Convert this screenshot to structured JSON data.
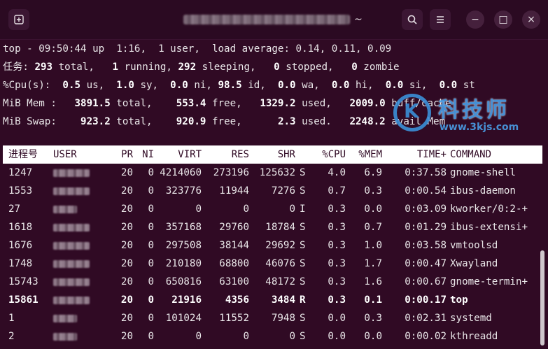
{
  "window": {
    "title_suffix": "~",
    "buttons": {
      "new_tab_icon": "new-tab-icon",
      "search_icon": "search-icon",
      "menu_icon": "hamburger-menu-icon",
      "minimize_label": "−",
      "maximize_label": "□",
      "close_label": "×"
    }
  },
  "summary": [
    [
      {
        "t": "top - 09:50:44 up  1:16,  1 user,  load average: 0.14, 0.11, 0.09"
      }
    ],
    [
      {
        "t": "任务: "
      },
      {
        "t": "293",
        "b": true
      },
      {
        "t": " total,   "
      },
      {
        "t": "1",
        "b": true
      },
      {
        "t": " running, "
      },
      {
        "t": "292",
        "b": true
      },
      {
        "t": " sleeping,   "
      },
      {
        "t": "0",
        "b": true
      },
      {
        "t": " stopped,   "
      },
      {
        "t": "0",
        "b": true
      },
      {
        "t": " zombie"
      }
    ],
    [
      {
        "t": "%Cpu(s):  "
      },
      {
        "t": "0.5",
        "b": true
      },
      {
        "t": " us,  "
      },
      {
        "t": "1.0",
        "b": true
      },
      {
        "t": " sy,  "
      },
      {
        "t": "0.0",
        "b": true
      },
      {
        "t": " ni, "
      },
      {
        "t": "98.5",
        "b": true
      },
      {
        "t": " id,  "
      },
      {
        "t": "0.0",
        "b": true
      },
      {
        "t": " wa,  "
      },
      {
        "t": "0.0",
        "b": true
      },
      {
        "t": " hi,  "
      },
      {
        "t": "0.0",
        "b": true
      },
      {
        "t": " si,  "
      },
      {
        "t": "0.0",
        "b": true
      },
      {
        "t": " st"
      }
    ],
    [
      {
        "t": "MiB Mem :   "
      },
      {
        "t": "3891.5",
        "b": true
      },
      {
        "t": " total,    "
      },
      {
        "t": "553.4",
        "b": true
      },
      {
        "t": " free,   "
      },
      {
        "t": "1329.2",
        "b": true
      },
      {
        "t": " used,   "
      },
      {
        "t": "2009.0",
        "b": true
      },
      {
        "t": " buff/cache"
      }
    ],
    [
      {
        "t": "MiB Swap:    "
      },
      {
        "t": "923.2",
        "b": true
      },
      {
        "t": " total,    "
      },
      {
        "t": "920.9",
        "b": true
      },
      {
        "t": " free,      "
      },
      {
        "t": "2.3",
        "b": true
      },
      {
        "t": " used.   "
      },
      {
        "t": "2248.2",
        "b": true
      },
      {
        "t": " avail Mem"
      }
    ]
  ],
  "table": {
    "columns": [
      "进程号",
      "USER",
      "PR",
      "NI",
      "VIRT",
      "RES",
      "SHR",
      "",
      "%CPU",
      "%MEM",
      "TIME+",
      "COMMAND"
    ],
    "rows": [
      {
        "pid": "1247",
        "user_w": 52,
        "pr": "20",
        "ni": "0",
        "virt": "4214060",
        "res": "273196",
        "shr": "125632",
        "s": "S",
        "cpu": "4.0",
        "mem": "6.9",
        "time": "0:37.58",
        "cmd": "gnome-shell"
      },
      {
        "pid": "1553",
        "user_w": 52,
        "pr": "20",
        "ni": "0",
        "virt": "323776",
        "res": "11944",
        "shr": "7276",
        "s": "S",
        "cpu": "0.7",
        "mem": "0.3",
        "time": "0:00.54",
        "cmd": "ibus-daemon"
      },
      {
        "pid": "27",
        "user_w": 34,
        "pr": "20",
        "ni": "0",
        "virt": "0",
        "res": "0",
        "shr": "0",
        "s": "I",
        "cpu": "0.3",
        "mem": "0.0",
        "time": "0:03.09",
        "cmd": "kworker/0:2-+"
      },
      {
        "pid": "1618",
        "user_w": 52,
        "pr": "20",
        "ni": "0",
        "virt": "357168",
        "res": "29760",
        "shr": "18784",
        "s": "S",
        "cpu": "0.3",
        "mem": "0.7",
        "time": "0:01.29",
        "cmd": "ibus-extensi+"
      },
      {
        "pid": "1676",
        "user_w": 52,
        "pr": "20",
        "ni": "0",
        "virt": "297508",
        "res": "38144",
        "shr": "29692",
        "s": "S",
        "cpu": "0.3",
        "mem": "1.0",
        "time": "0:03.58",
        "cmd": "vmtoolsd"
      },
      {
        "pid": "1748",
        "user_w": 52,
        "pr": "20",
        "ni": "0",
        "virt": "210180",
        "res": "68800",
        "shr": "46076",
        "s": "S",
        "cpu": "0.3",
        "mem": "1.7",
        "time": "0:00.47",
        "cmd": "Xwayland"
      },
      {
        "pid": "15743",
        "user_w": 52,
        "pr": "20",
        "ni": "0",
        "virt": "650816",
        "res": "63100",
        "shr": "48172",
        "s": "S",
        "cpu": "0.3",
        "mem": "1.6",
        "time": "0:00.67",
        "cmd": "gnome-termin+"
      },
      {
        "pid": "15861",
        "user_w": 52,
        "pr": "20",
        "ni": "0",
        "virt": "21916",
        "res": "4356",
        "shr": "3484",
        "s": "R",
        "cpu": "0.3",
        "mem": "0.1",
        "time": "0:00.17",
        "cmd": "top",
        "bold": true
      },
      {
        "pid": "1",
        "user_w": 34,
        "pr": "20",
        "ni": "0",
        "virt": "101024",
        "res": "11552",
        "shr": "7948",
        "s": "S",
        "cpu": "0.0",
        "mem": "0.3",
        "time": "0:02.31",
        "cmd": "systemd"
      },
      {
        "pid": "2",
        "user_w": 34,
        "pr": "20",
        "ni": "0",
        "virt": "0",
        "res": "0",
        "shr": "0",
        "s": "S",
        "cpu": "0.0",
        "mem": "0.0",
        "time": "0:00.02",
        "cmd": "kthreadd"
      }
    ]
  },
  "watermark": {
    "cn": "科技师",
    "url": "www.3kjs.com"
  },
  "colors": {
    "terminal_bg": "#300a24",
    "header_bg": "#ffffff",
    "text": "#e9e6e8"
  }
}
